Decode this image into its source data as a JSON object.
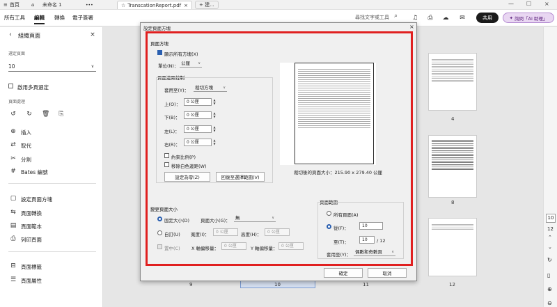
{
  "tabs": {
    "home_label": "首頁",
    "doc1": "未命名 1",
    "doc2": "TranscationReport.pdf",
    "new_tab": "+ 建..."
  },
  "menu": {
    "all_tools": "所有工具",
    "edit": "編輯",
    "convert": "轉換",
    "esign": "電子簽署"
  },
  "toolbar": {
    "search_placeholder": "尋找文字或工具",
    "share": "共用",
    "ai": "詢問「AI 助理」"
  },
  "left_panel": {
    "title": "組織頁面",
    "selected_label": "選定頁面",
    "selected_value": "10",
    "multi_select": "啟用多頁選定",
    "page_ops_label": "頁面處理",
    "items": [
      "插入",
      "取代",
      "分割",
      "Bates 編號"
    ],
    "items2": [
      "設定頁面方塊",
      "頁面轉換",
      "頁面範本",
      "列印頁面"
    ],
    "items3": [
      "頁面標籤",
      "頁面屬性"
    ]
  },
  "pages": {
    "p4": "4",
    "p8": "8",
    "p12": "12",
    "p9": "9",
    "p10": "10",
    "p11": "11"
  },
  "right_rail": {
    "current": "10",
    "total": "12"
  },
  "dialog": {
    "title": "設定頁面方塊",
    "section_box": "頁面方塊",
    "show_all": "顯示所有方塊(X)",
    "unit_label": "單位(N)：",
    "unit_value": "公厘",
    "margin_ctrl": "頁面邊距控制",
    "apply_to_label": "套用至(Y)：",
    "apply_to_value": "裁切方塊",
    "top_label": "上(O)：",
    "top_value": "0 公厘",
    "bottom_label": "下(B)：",
    "bottom_value": "0 公厘",
    "left_label": "左(L)：",
    "left_value": "0 公厘",
    "right_label": "右(R)：",
    "right_value": "0 公厘",
    "constrain": "約束比例(P)",
    "remove_white": "移除白色邊距(W)",
    "set_zero": "設定為零(Z)",
    "revert": "回復至選擇範圍(V)",
    "crop_size": "裁切後的頁面大小：215.90 x 279.40 公厘",
    "change_size": "變更頁面大小",
    "fixed_size": "固定大小(D)",
    "page_size_label": "頁面大小(G)：",
    "page_size_value": "無",
    "custom": "自訂(U)",
    "width_label": "寬度(I)：",
    "width_value": "0 公厘",
    "height_label": "高度(H)：",
    "height_value": "0 公厘",
    "center": "置中(C)",
    "x_offset": "X 軸偏移量：",
    "x_value": "0 公厘",
    "y_offset": "Y 軸偏移量：",
    "y_value": "0 公厘",
    "page_range": "頁面範圍",
    "all_pages": "所有頁面(A)",
    "from_label": "從(F)：",
    "from_value": "10",
    "to_label": "至(T)：",
    "to_value": "10",
    "of_total": "/ 12",
    "apply_label": "套用至(Y)：",
    "apply_value": "偶數和奇數頁",
    "ok": "確定",
    "cancel": "取消"
  },
  "colors": {
    "highlight": "#e02020",
    "accent": "#2a5fb0"
  }
}
